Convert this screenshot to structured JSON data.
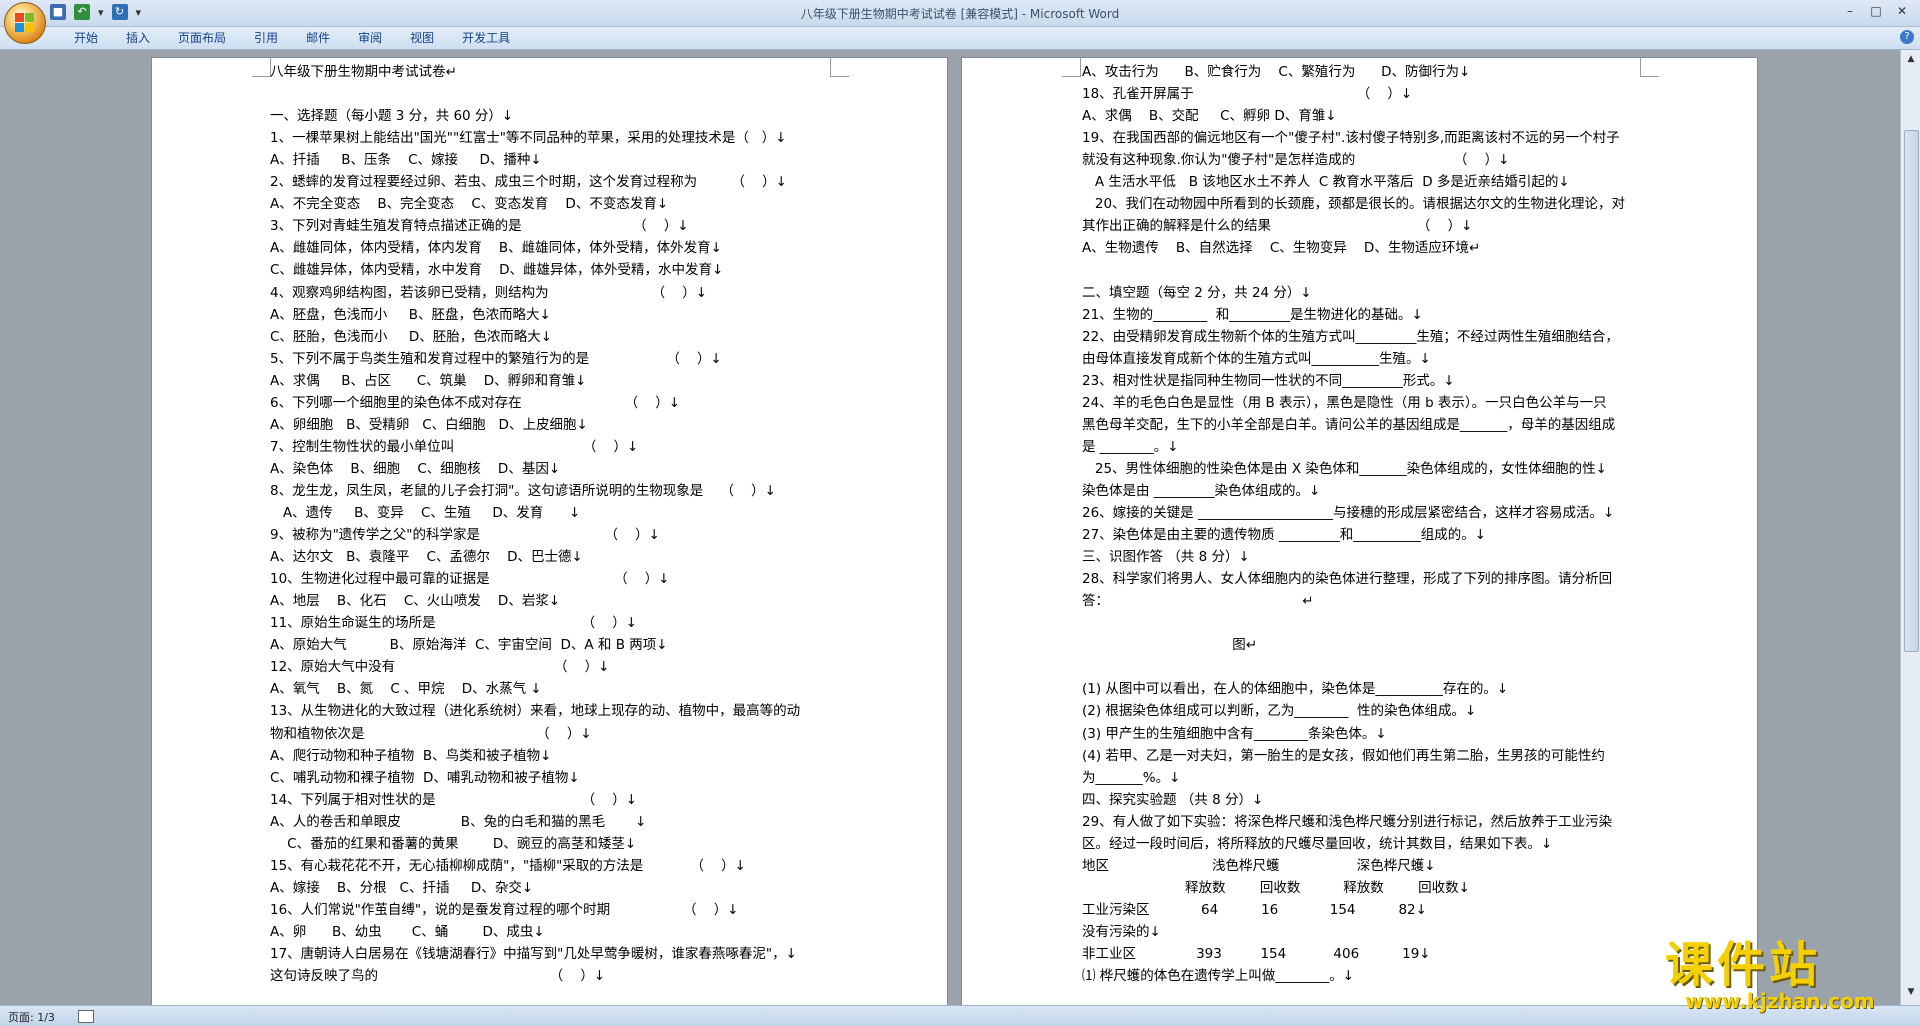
{
  "window": {
    "title": "八年级下册生物期中考试试卷 [兼容模式] - Microsoft Word"
  },
  "ribbon": {
    "tabs": [
      "开始",
      "插入",
      "页面布局",
      "引用",
      "邮件",
      "审阅",
      "视图",
      "开发工具"
    ]
  },
  "document": {
    "left_page_lines": [
      "八年级下册生物期中考试试卷↵",
      "",
      "一、选择题（每小题 3 分，共 60 分）↓",
      "1、一棵苹果树上能结出\"国光\"\"红富士\"等不同品种的苹果，采用的处理技术是（   ）↓",
      "A、扦插     B、压条    C、嫁接     D、播种↓",
      "2、蟋蟀的发育过程要经过卵、若虫、成虫三个时期，这个发育过程称为        （    ）↓",
      "A、不完全变态    B、完全变态    C、变态发育    D、不变态发育↓",
      "3、下列对青蛙生殖发育特点描述正确的是                          （    ）↓",
      "A、雌雄同体，体内受精，体内发育    B、雌雄同体，体外受精，体外发育↓",
      "C、雌雄异体，体内受精，水中发育    D、雌雄异体，体外受精，水中发育↓",
      "4、观察鸡卵结构图，若该卵已受精，则结构为                        （    ）↓",
      "A、胚盘，色浅而小     B、胚盘，色浓而略大↓",
      "C、胚胎，色浅而小     D、胚胎，色浓而略大↓",
      "5、下列不属于鸟类生殖和发育过程中的繁殖行为的是                  （    ）↓",
      "A、求偶     B、占区      C、筑巢    D、孵卵和育雏↓",
      "6、下列哪一个细胞里的染色体不成对存在                        （    ）↓",
      "A、卵细胞   B、受精卵   C、白细胞   D、上皮细胞↓",
      "7、控制生物性状的最小单位叫                              （    ）↓",
      "A、染色体    B、细胞    C、细胞核    D、基因↓",
      "8、龙生龙，凤生凤，老鼠的儿子会打洞\"。这句谚语所说明的生物现象是    （    ）↓",
      "   A、遗传     B、变异    C、生殖     D、发育      ↓",
      "9、被称为\"遗传学之父\"的科学家是                             （    ）↓",
      "A、达尔文   B、袁隆平    C、孟德尔    D、巴士德↓",
      "10、生物进化过程中最可靠的证据是                             （    ）↓",
      "A、地层    B、化石    C、火山喷发    D、岩浆↓",
      "11、原始生命诞生的场所是                                  （    ）↓",
      "A、原始大气          B、原始海洋  C、宇宙空间  D、A 和 B 两项↓",
      "12、原始大气中没有                                     （    ）↓",
      "A、氧气    B、氮    C 、甲烷    D、水蒸气 ↓",
      "13、从生物进化的大致过程（进化系统树）来看，地球上现存的动、植物中，最高等的动",
      "物和植物依次是                                        （    ）↓",
      "A、爬行动物和种子植物  B、鸟类和被子植物↓",
      "C、哺乳动物和裸子植物  D、哺乳动物和被子植物↓",
      "14、下列属于相对性状的是                                  （    ）↓",
      "A、人的卷舌和单眼皮              B、兔的白毛和猫的黑毛       ↓",
      "    C、番茄的红果和番薯的黄果        D、豌豆的高茎和矮茎↓",
      "15、有心栽花花不开，无心插柳柳成荫\"，\"插柳\"采取的方法是           （    ）↓",
      "A、嫁接    B、分根   C、扦插     D、杂交↓",
      "16、人们常说\"作茧自缚\"，说的是蚕发育过程的哪个时期                 （    ）↓",
      "A、卵      B、幼虫       C、蛹        D、成虫↓",
      "17、唐朝诗人白居易在《钱塘湖春行》中描写到\"几处早莺争暖树，谁家春燕啄春泥\"，↓",
      "这句诗反映了鸟的                                        （    ）↓"
    ],
    "right_page_lines": [
      "A、攻击行为      B、贮食行为    C、繁殖行为      D、防御行为↓",
      "18、孔雀开屏属于                                      （    ）↓",
      "A、求偶    B、交配     C、孵卵 D、育雏↓",
      "19、在我国西部的偏远地区有一个\"傻子村\".该村傻子特别多,而距离该村不远的另一个村子",
      "就没有这种现象.你认为\"傻子村\"是怎样造成的                       （    ）↓",
      "   A 生活水平低   B 该地区水土不养人  C 教育水平落后  D 多是近亲结婚引起的↓",
      "   20、我们在动物园中所看到的长颈鹿，颈都是很长的。请根据达尔文的生物进化理论，对",
      "其作出正确的解释是什么的结果                                  （    ）↓",
      "A、生物遗传    B、自然选择    C、生物变异    D、生物适应环境↵",
      "",
      "二、填空题（每空 2 分，共 24 分）↓",
      "21、生物的________  和_________是生物进化的基础。↓",
      "22、由受精卵发育成生物新个体的生殖方式叫_________生殖；不经过两性生殖细胞结合，",
      "由母体直接发育成新个体的生殖方式叫__________生殖。↓",
      "23、相对性状是指同种生物同一性状的不同_________形式。↓",
      "24、羊的毛色白色是显性（用 B 表示），黑色是隐性（用 b 表示）。一只白色公羊与一只",
      "黑色母羊交配，生下的小羊全部是白羊。请问公羊的基因组成是_______，母羊的基因组成",
      "是 ________。↓",
      "   25、男性体细胞的性染色体是由 X 染色体和_______染色体组成的，女性体细胞的性↓",
      "染色体是由 _________染色体组成的。↓",
      "26、嫁接的关键是 ____________________与接穗的形成层紧密结合，这样才容易成活。↓",
      "27、染色体是由主要的遗传物质 _________和__________组成的。↓",
      "三、识图作答 （共 8 分）↓",
      "28、科学家们将男人、女人体细胞内的染色体进行整理，形成了下列的排序图。请分析回",
      "答：                                             ↵",
      "",
      "                                   图↵",
      "",
      "(1) 从图中可以看出，在人的体细胞中，染色体是__________存在的。↓",
      "(2) 根据染色体组成可以判断，乙为________  性的染色体组成。↓",
      "(3) 甲产生的生殖细胞中含有________条染色体。↓",
      "(4) 若甲、乙是一对夫妇，第一胎生的是女孩，假如他们再生第二胎，生男孩的可能性约",
      "为_______%。↓",
      "四、探究实验题 （共 8 分）↓",
      "29、有人做了如下实验：将深色桦尺蠖和浅色桦尺蠖分别进行标记，然后放养于工业污染",
      "区。经过一段时间后，将所释放的尺蠖尽量回收，统计其数目，结果如下表。↓",
      "地区                        浅色桦尺蠖                  深色桦尺蠖↓",
      "                        释放数        回收数          释放数        回收数↓",
      "工业污染区            64          16            154          82↓",
      "没有污染的↓",
      "非工业区              393         154           406          19↓",
      "⑴ 桦尺蠖的体色在遗传学上叫做________。↓"
    ]
  },
  "status": {
    "page_label": "页面: 1/3"
  },
  "watermark": {
    "big": "课件站",
    "small": "www.kjzhan.com"
  }
}
